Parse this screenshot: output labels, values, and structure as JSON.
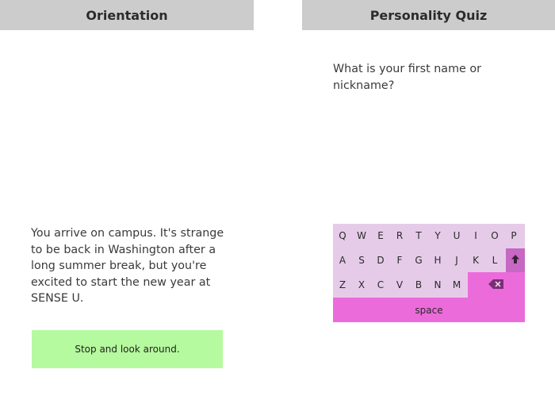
{
  "orientation_screen": {
    "title": "Orientation",
    "story": "You arrive on campus. It's strange to be back in Washington after a long summer break, but you're excited to start the new year at SENSE U.",
    "choice_label": "Stop and look around."
  },
  "quiz_screen": {
    "title": "Personality Quiz",
    "question": "What is your first name or nickname?",
    "keyboard": {
      "row1": [
        "Q",
        "W",
        "E",
        "R",
        "T",
        "Y",
        "U",
        "I",
        "O",
        "P"
      ],
      "row2": [
        "A",
        "S",
        "D",
        "F",
        "G",
        "H",
        "J",
        "K",
        "L"
      ],
      "row3": [
        "Z",
        "X",
        "C",
        "V",
        "B",
        "N",
        "M"
      ],
      "space_label": "space",
      "shift_icon": "shift-arrow-icon",
      "backspace_icon": "backspace-icon",
      "colors": {
        "base": "#e6cbe9",
        "accent": "#ec6bdb",
        "shift": "#c668c4"
      }
    }
  }
}
